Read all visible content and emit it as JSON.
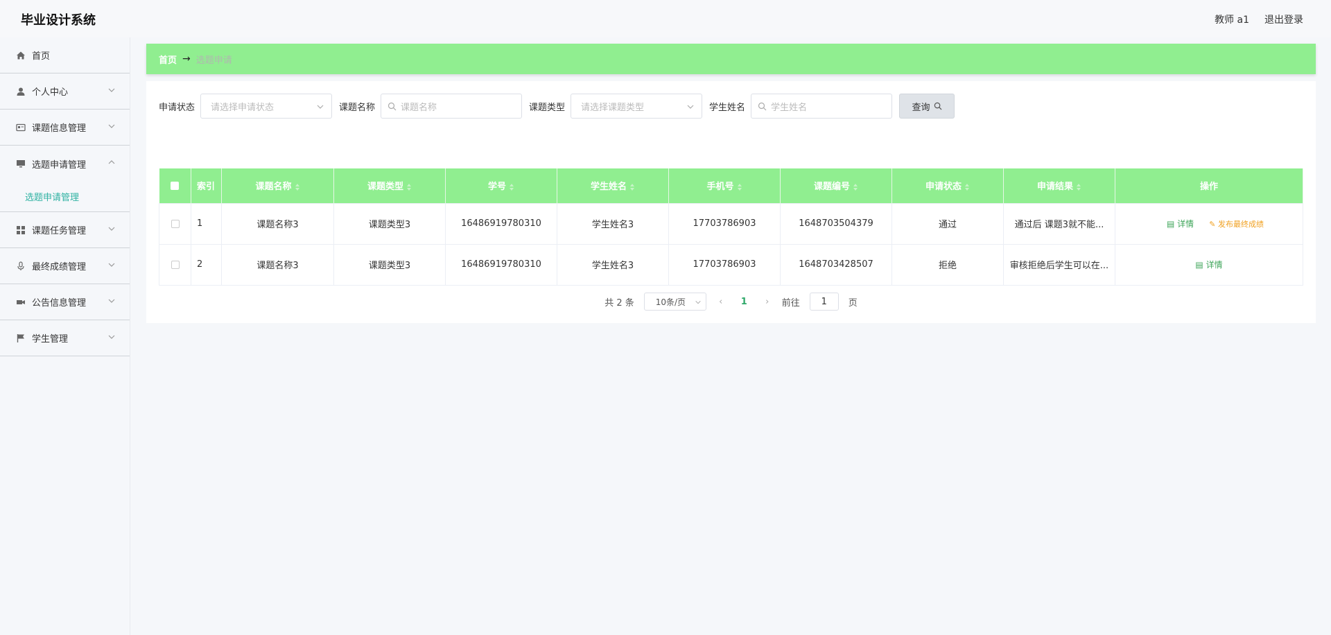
{
  "header": {
    "title": "毕业设计系统",
    "user": "教师 a1",
    "logout": "退出登录"
  },
  "sidebar": {
    "items": [
      {
        "label": "首页",
        "icon": "home-icon"
      },
      {
        "label": "个人中心",
        "icon": "user-icon"
      },
      {
        "label": "课题信息管理",
        "icon": "card-icon"
      },
      {
        "label": "选题申请管理",
        "icon": "monitor-icon",
        "expanded": true,
        "sub": "选题申请管理"
      },
      {
        "label": "课题任务管理",
        "icon": "grid-icon"
      },
      {
        "label": "最终成绩管理",
        "icon": "mic-icon"
      },
      {
        "label": "公告信息管理",
        "icon": "camera-icon"
      },
      {
        "label": "学生管理",
        "icon": "flag-icon"
      }
    ]
  },
  "breadcrumb": {
    "home": "首页",
    "arrow": "→",
    "current": "选题申请"
  },
  "search": {
    "status_label": "申请状态",
    "status_placeholder": "请选择申请状态",
    "name_label": "课题名称",
    "name_placeholder": "课题名称",
    "type_label": "课题类型",
    "type_placeholder": "请选择课题类型",
    "student_label": "学生姓名",
    "student_placeholder": "学生姓名",
    "query_button": "查询"
  },
  "table": {
    "columns": [
      "索引",
      "课题名称",
      "课题类型",
      "学号",
      "学生姓名",
      "手机号",
      "课题编号",
      "申请状态",
      "申请结果",
      "操作"
    ],
    "rows": [
      {
        "index": "1",
        "name": "课题名称3",
        "type": "课题类型3",
        "student_no": "16486919780310",
        "student": "学生姓名3",
        "phone": "17703786903",
        "topic_no": "1648703504379",
        "status": "通过",
        "result": "通过后 课题3就不能...",
        "detail": "详情",
        "score": "发布最终成绩"
      },
      {
        "index": "2",
        "name": "课题名称3",
        "type": "课题类型3",
        "student_no": "16486919780310",
        "student": "学生姓名3",
        "phone": "17703786903",
        "topic_no": "1648703428507",
        "status": "拒绝",
        "result": "审核拒绝后学生可以在...",
        "detail": "详情"
      }
    ]
  },
  "pagination": {
    "total": "共 2 条",
    "page_size": "10条/页",
    "current": "1",
    "goto": "前往",
    "page_unit": "页",
    "jump_value": "1"
  },
  "colors": {
    "accent": "#90ee90",
    "sub_active": "#2fb2a2",
    "detail": "#3fa55a",
    "score": "#f0a020"
  }
}
